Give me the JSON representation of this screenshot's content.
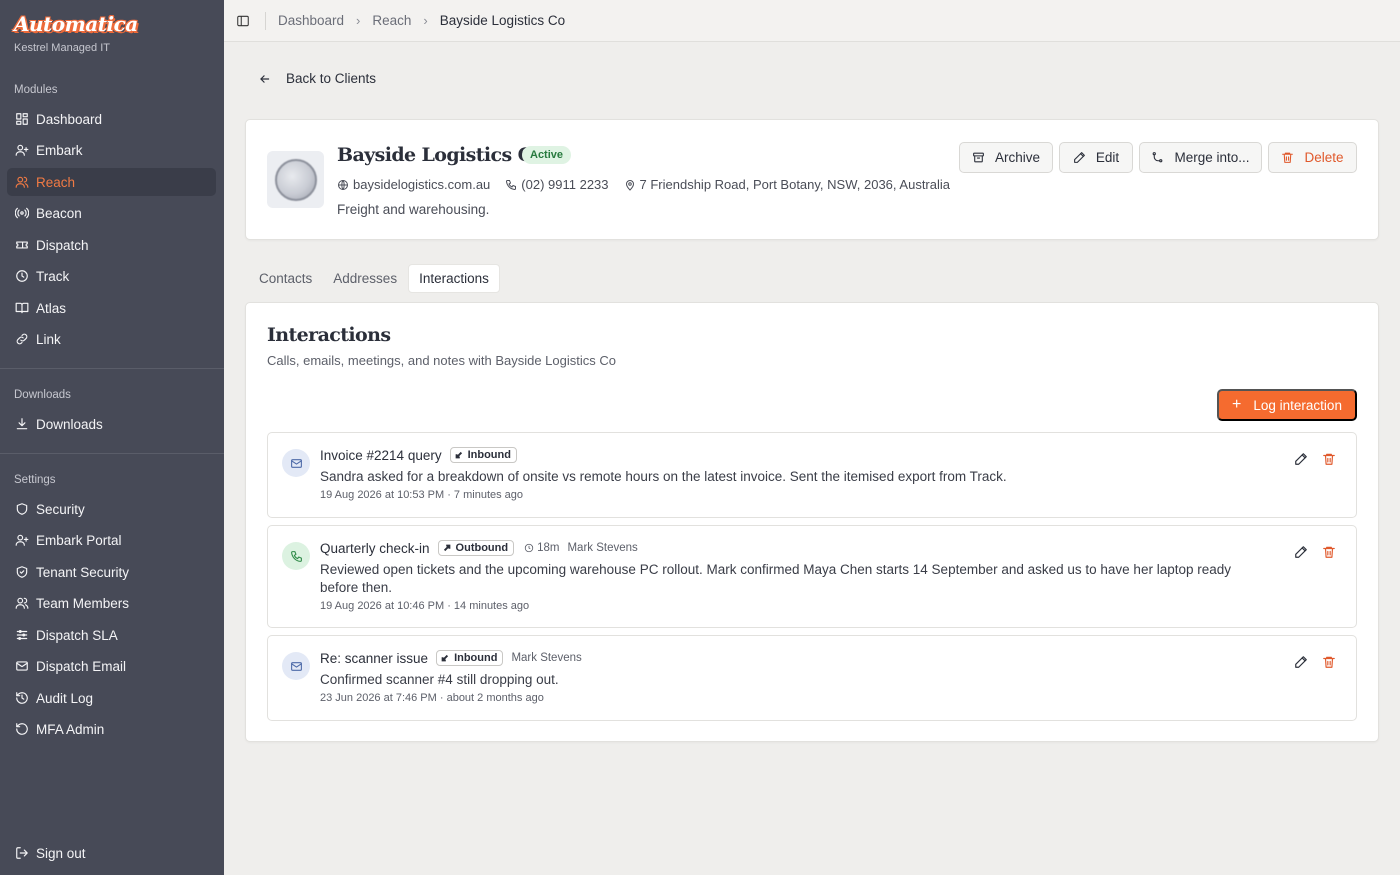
{
  "sidebar": {
    "brand": "Automatica",
    "org": "Kestrel Managed IT",
    "sections": {
      "modules": "Modules",
      "downloads": "Downloads",
      "settings": "Settings"
    },
    "modules": [
      {
        "label": "Dashboard",
        "icon": "dashboard-icon"
      },
      {
        "label": "Embark",
        "icon": "user-plus-icon"
      },
      {
        "label": "Reach",
        "icon": "users-icon"
      },
      {
        "label": "Beacon",
        "icon": "broadcast-icon"
      },
      {
        "label": "Dispatch",
        "icon": "ticket-icon"
      },
      {
        "label": "Track",
        "icon": "clock-icon"
      },
      {
        "label": "Atlas",
        "icon": "book-icon"
      },
      {
        "label": "Link",
        "icon": "link-icon"
      }
    ],
    "downloads": [
      {
        "label": "Downloads",
        "icon": "download-icon"
      }
    ],
    "settings": [
      {
        "label": "Security",
        "icon": "shield-icon"
      },
      {
        "label": "Embark Portal",
        "icon": "user-plus-icon"
      },
      {
        "label": "Tenant Security",
        "icon": "shield-check-icon"
      },
      {
        "label": "Team Members",
        "icon": "users-icon"
      },
      {
        "label": "Dispatch SLA",
        "icon": "sliders-icon"
      },
      {
        "label": "Dispatch Email",
        "icon": "mail-icon"
      },
      {
        "label": "Audit Log",
        "icon": "history-icon"
      },
      {
        "label": "MFA Admin",
        "icon": "rotate-icon"
      }
    ],
    "sign_out": "Sign out",
    "accent": "#f07a44"
  },
  "breadcrumb": [
    "Dashboard",
    "Reach",
    "Bayside Logistics Co"
  ],
  "back_label": "Back to Clients",
  "client": {
    "name": "Bayside Logistics Co",
    "status": "Active",
    "website": "baysidelogistics.com.au",
    "phone": "(02) 9911 2233",
    "address": "7 Friendship Road, Port Botany, NSW, 2036, Australia",
    "description": "Freight and warehousing."
  },
  "actions": {
    "archive": "Archive",
    "edit": "Edit",
    "merge": "Merge into...",
    "delete": "Delete"
  },
  "tabs": [
    "Contacts",
    "Addresses",
    "Interactions"
  ],
  "active_tab": "Interactions",
  "interactions": {
    "title": "Interactions",
    "subtitle": "Calls, emails, meetings, and notes with Bayside Logistics Co",
    "log_button": "Log interaction",
    "items": [
      {
        "type": "email",
        "title": "Invoice #2214 query",
        "direction": "Inbound",
        "duration": "",
        "person": "",
        "body": "Sandra asked for a breakdown of onsite vs remote hours on the latest invoice. Sent the itemised export from Track.",
        "time": "19 Aug 2026 at 10:53 PM · 7 minutes ago"
      },
      {
        "type": "call",
        "title": "Quarterly check-in",
        "direction": "Outbound",
        "duration": "18m",
        "person": "Mark Stevens",
        "body": "Reviewed open tickets and the upcoming warehouse PC rollout. Mark confirmed Maya Chen starts 14 September and asked us to have her laptop ready before then.",
        "time": "19 Aug 2026 at 10:46 PM · 14 minutes ago"
      },
      {
        "type": "email",
        "title": "Re: scanner issue",
        "direction": "Inbound",
        "duration": "",
        "person": "Mark Stevens",
        "body": "Confirmed scanner #4 still dropping out.",
        "time": "23 Jun 2026 at 7:46 PM · about 2 months ago"
      }
    ]
  },
  "colors": {
    "primary": "#f56b2f",
    "danger": "#e0592c",
    "active_badge_bg": "#dff3e3",
    "sidebar_bg": "#474a57"
  }
}
